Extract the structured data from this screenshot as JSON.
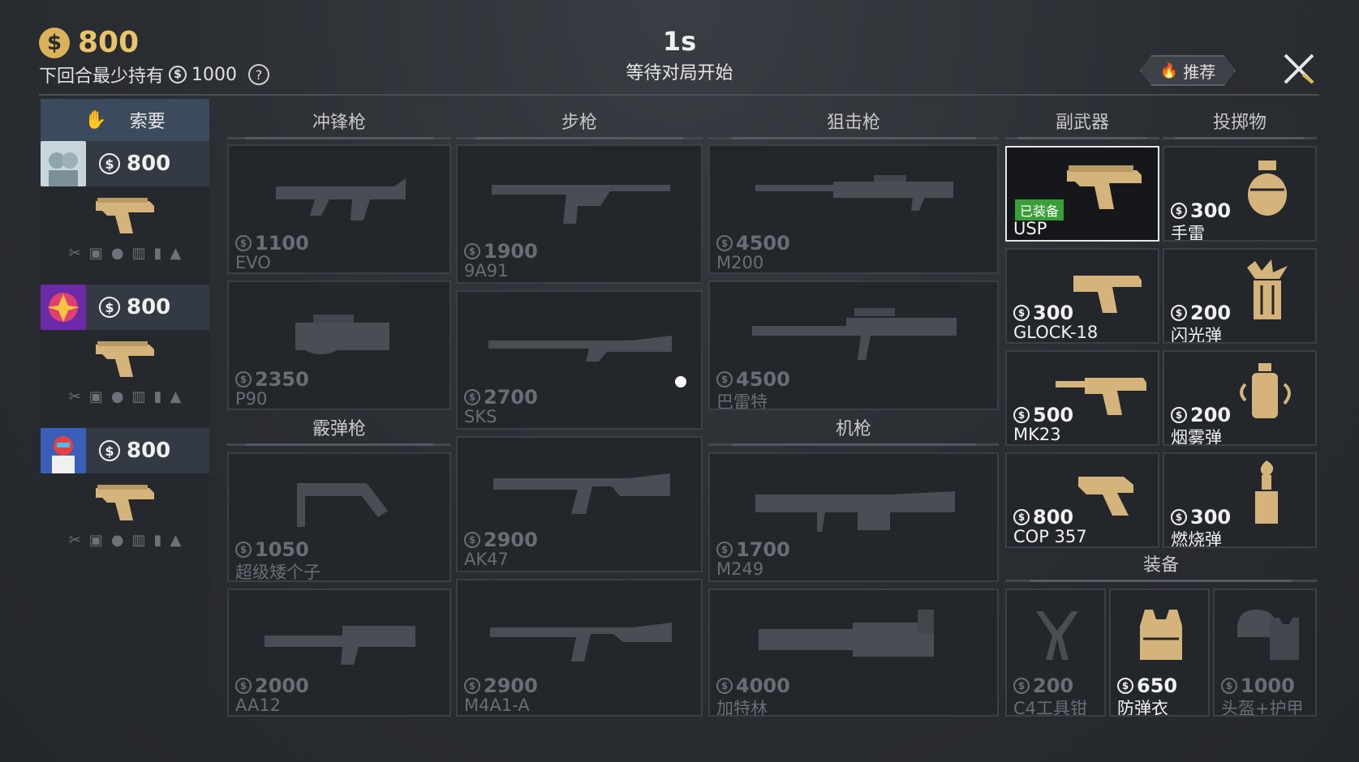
{
  "header": {
    "money": "800",
    "min_hold_label": "下回合最少持有",
    "min_hold_value": "1000",
    "help": "?",
    "timer": "1s",
    "status": "等待对局开始",
    "recommend": "推荐"
  },
  "left": {
    "ask_label": "索要",
    "players": [
      {
        "money": "800"
      },
      {
        "money": "800"
      },
      {
        "money": "800"
      }
    ]
  },
  "categories": {
    "smg": "冲锋枪",
    "rifle": "步枪",
    "sniper": "狙击枪",
    "secondary": "副武器",
    "throwable": "投掷物",
    "shotgun": "霰弹枪",
    "mg": "机枪",
    "equipment": "装备"
  },
  "items": {
    "evo": {
      "price": "1100",
      "name": "EVO"
    },
    "p90": {
      "price": "2350",
      "name": "P90"
    },
    "shotgun1": {
      "price": "1050",
      "name": "超级矮个子"
    },
    "aa12": {
      "price": "2000",
      "name": "AA12"
    },
    "9a91": {
      "price": "1900",
      "name": "9A91"
    },
    "sks": {
      "price": "2700",
      "name": "SKS"
    },
    "ak47": {
      "price": "2900",
      "name": "AK47"
    },
    "m4a1": {
      "price": "2900",
      "name": "M4A1-A"
    },
    "m200": {
      "price": "4500",
      "name": "M200"
    },
    "barrett": {
      "price": "4500",
      "name": "巴雷特"
    },
    "m249": {
      "price": "1700",
      "name": "M249"
    },
    "gatling": {
      "price": "4000",
      "name": "加特林"
    },
    "usp": {
      "name": "USP",
      "badge": "已装备"
    },
    "glock": {
      "price": "300",
      "name": "GLOCK-18"
    },
    "mk23": {
      "price": "500",
      "name": "MK23"
    },
    "cop357": {
      "price": "800",
      "name": "COP 357"
    },
    "grenade": {
      "price": "300",
      "name": "手雷"
    },
    "flash": {
      "price": "200",
      "name": "闪光弹"
    },
    "smoke": {
      "price": "200",
      "name": "烟雾弹"
    },
    "molotov": {
      "price": "300",
      "name": "燃烧弹"
    },
    "c4": {
      "price": "200",
      "name": "C4工具钳"
    },
    "vest": {
      "price": "650",
      "name": "防弹衣"
    },
    "helmet": {
      "price": "1000",
      "name": "头盔+护甲"
    }
  },
  "colors": {
    "gold": "#d4b47a",
    "locked": "#6a6e74",
    "equipped": "#3a9e3a"
  }
}
